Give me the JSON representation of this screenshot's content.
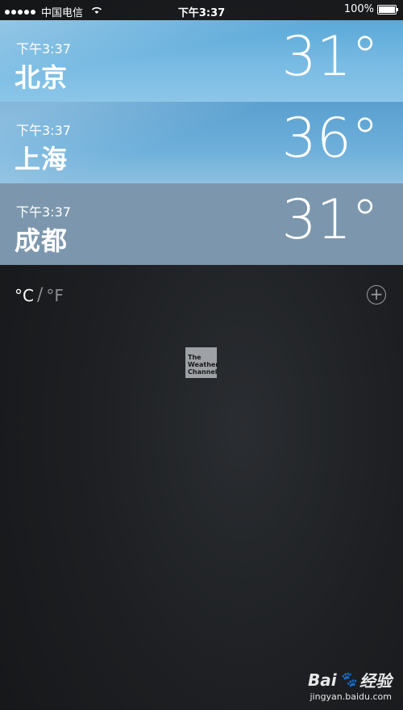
{
  "status_bar": {
    "carrier": "中国电信",
    "time": "下午3:37",
    "battery": "100%",
    "battery_level": 1.0
  },
  "cities": [
    {
      "time": "下午3:37",
      "name": "北京",
      "temp": "31°"
    },
    {
      "time": "下午3:37",
      "name": "上海",
      "temp": "36°"
    },
    {
      "time": "下午3:37",
      "name": "成都",
      "temp": "31°"
    }
  ],
  "units": {
    "celsius": "°C",
    "separator": "/",
    "fahrenheit": "°F"
  },
  "add_button": {
    "icon": "plus-circle-icon",
    "glyph": "+"
  },
  "logo": {
    "line1": "The",
    "line2": "Weather",
    "line3": "Channel"
  },
  "watermark": {
    "brand": "Bai",
    "brand2": "经验",
    "url": "jingyan.baidu.com"
  }
}
